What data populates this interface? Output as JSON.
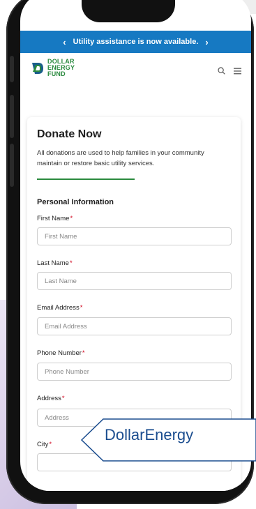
{
  "banner": {
    "text": "Utility assistance is now available.",
    "prev_icon": "chevron-left-icon",
    "next_icon": "chevron-right-icon"
  },
  "logo": {
    "line1": "DOLLAR",
    "line2": "ENERGY",
    "line3": "FUND"
  },
  "header": {
    "search_icon": "search-icon",
    "menu_icon": "menu-icon"
  },
  "form": {
    "title": "Donate Now",
    "description": "All donations are used to help families in your community maintain or restore basic utility services.",
    "section_title": "Personal Information",
    "required_mark": "*",
    "fields": [
      {
        "label": "First Name",
        "placeholder": "First Name"
      },
      {
        "label": "Last Name",
        "placeholder": "Last Name"
      },
      {
        "label": "Email Address",
        "placeholder": "Email Address"
      },
      {
        "label": "Phone Number",
        "placeholder": "Phone Number"
      },
      {
        "label": "Address",
        "placeholder": "Address"
      },
      {
        "label": "City",
        "placeholder": ""
      }
    ]
  },
  "callout": {
    "text": "DollarEnergy"
  },
  "colors": {
    "banner": "#1679c2",
    "brand_green": "#2a8a3e",
    "required": "#d0021b",
    "callout_text": "#1b4d8f"
  }
}
